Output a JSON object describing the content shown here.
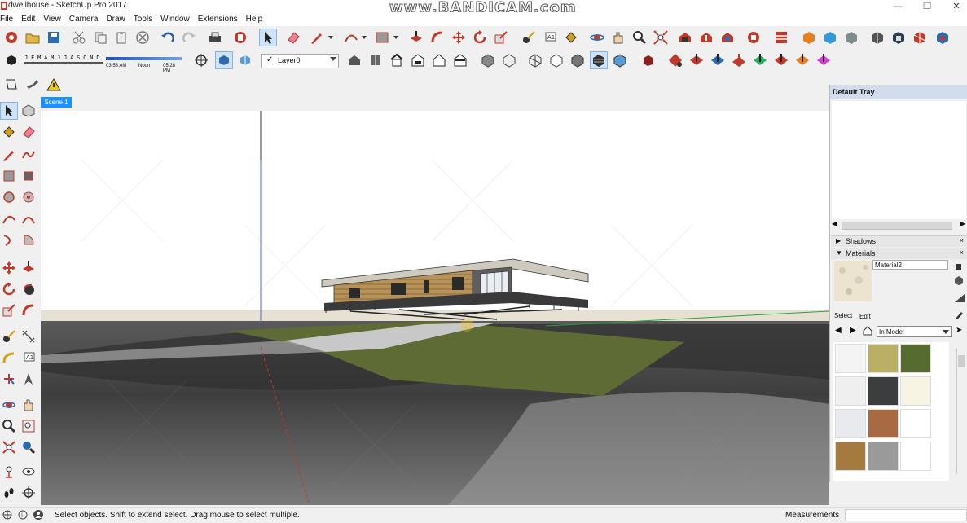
{
  "window": {
    "title": "dwellhouse - SketchUp Pro 2017",
    "watermark": "www.BANDICAM.com"
  },
  "menu": [
    "File",
    "Edit",
    "View",
    "Camera",
    "Draw",
    "Tools",
    "Window",
    "Extensions",
    "Help"
  ],
  "shadow_settings": {
    "months": "J F M A M J J A S O N D",
    "time_start": "03:53 AM",
    "time_noon": "Noon",
    "time_end": "05:28 PM"
  },
  "layer": {
    "current": "Layer0"
  },
  "scene_tab": "Scene 1",
  "tray": {
    "title": "Default Tray",
    "panels": {
      "shadows": "Shadows",
      "materials": "Materials"
    },
    "material_name": "Material2",
    "tabs": {
      "select": "Select",
      "edit": "Edit"
    },
    "collection": "In Model",
    "swatch_colors": [
      "#f4f4f4",
      "#b9b066",
      "#566b2f",
      "#efefef",
      "#3b3d3e",
      "#f7f4e4",
      "#e8eaee",
      "#a86a43",
      "#ffffff",
      "#a57a3e",
      "#9a9a9a",
      "#ffffff"
    ]
  },
  "status": {
    "message": "Select objects. Shift to extend select. Drag mouse to select multiple.",
    "measurements_label": "Measurements"
  },
  "colors": {
    "accent": "#1e90ff",
    "tray_header": "#d2dceb"
  }
}
